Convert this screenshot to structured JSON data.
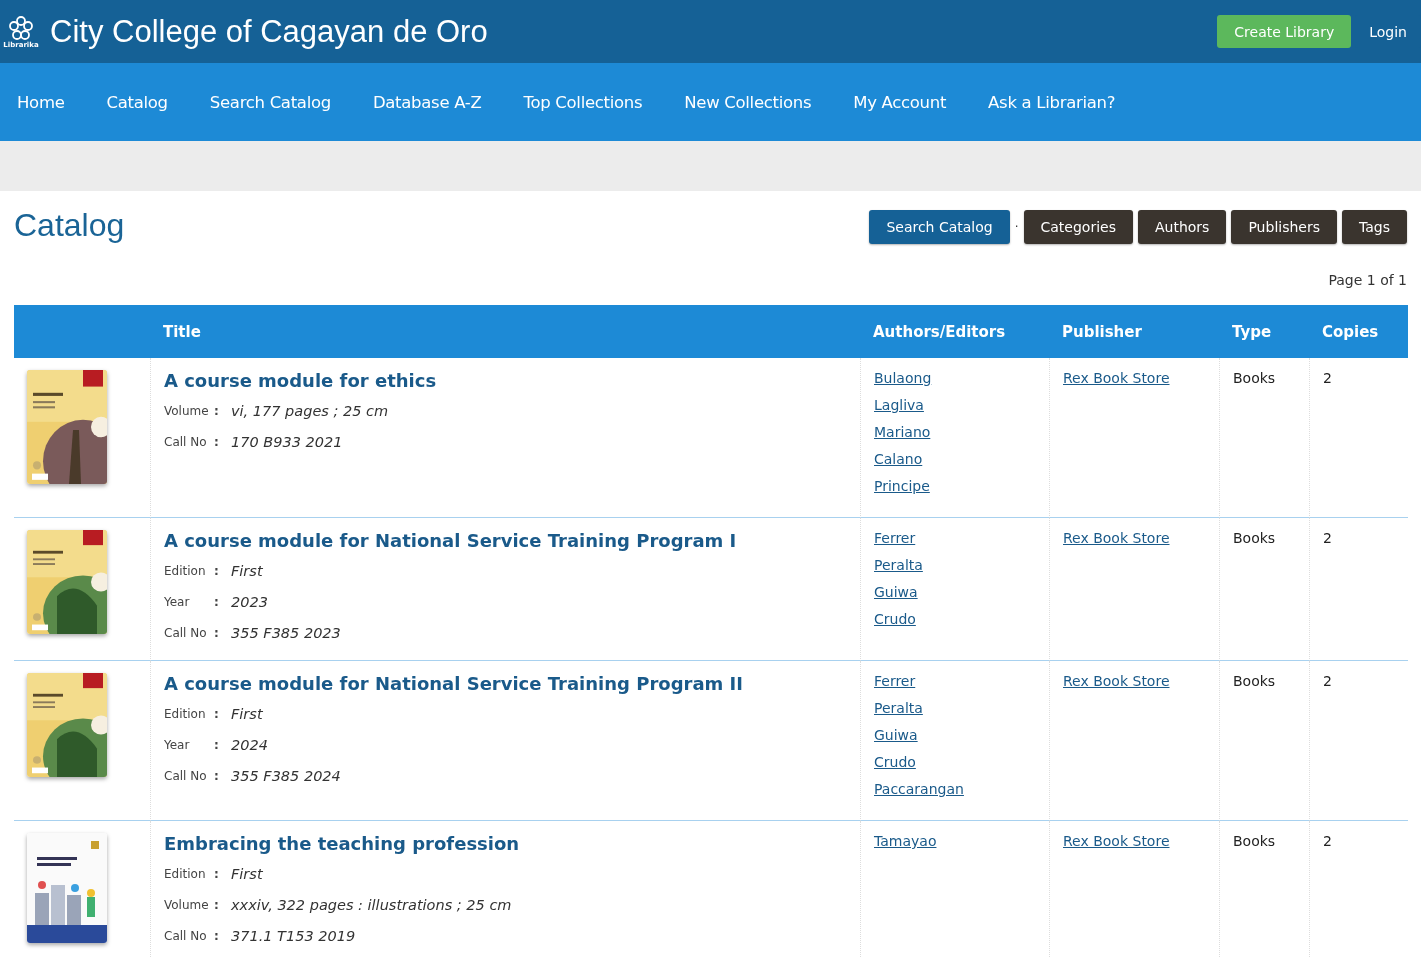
{
  "header": {
    "logo_caption": "Librarika",
    "title": "City College of Cagayan de Oro",
    "buttons": [
      {
        "label": "Create Library",
        "kind": "primary"
      },
      {
        "label": "Login",
        "kind": "plain"
      }
    ]
  },
  "nav": [
    "Home",
    "Catalog",
    "Search Catalog",
    "Database A-Z",
    "Top Collections",
    "New Collections",
    "My Account",
    "Ask a Librarian?"
  ],
  "page": {
    "title": "Catalog",
    "separator": "·",
    "tabs": [
      {
        "label": "Search Catalog",
        "selected": true
      },
      {
        "label": "Categories",
        "selected": false
      },
      {
        "label": "Authors",
        "selected": false
      },
      {
        "label": "Publishers",
        "selected": false
      },
      {
        "label": "Tags",
        "selected": false
      }
    ],
    "pagination": "Page 1 of 1"
  },
  "table": {
    "columns": [
      "Title",
      "Authors/Editors",
      "Publisher",
      "Type",
      "Copies"
    ],
    "rows": [
      {
        "title": "A course module for ethics",
        "details": [
          {
            "label": "Volume",
            "colon": ":",
            "value": "vi, 177 pages ; 25 cm"
          },
          {
            "label": "Call No",
            "colon": ":",
            "value": "170 B933 2021"
          }
        ],
        "authors": [
          "Bulaong",
          "Lagliva",
          "Mariano",
          "Calano",
          "Principe"
        ],
        "publisher": "Rex Book Store",
        "type": "Books",
        "copies": "2"
      },
      {
        "title": "A course module for National Service Training Program I",
        "details": [
          {
            "label": "Edition",
            "colon": ":",
            "value": "First"
          },
          {
            "label": "Year",
            "colon": ":",
            "value": "2023"
          },
          {
            "label": "Call No",
            "colon": ":",
            "value": "355 F385 2023"
          }
        ],
        "authors": [
          "Ferrer",
          "Peralta",
          "Guiwa",
          "Crudo"
        ],
        "publisher": "Rex Book Store",
        "type": "Books",
        "copies": "2"
      },
      {
        "title": "A course module for National Service Training Program II",
        "details": [
          {
            "label": "Edition",
            "colon": ":",
            "value": "First"
          },
          {
            "label": "Year",
            "colon": ":",
            "value": "2024"
          },
          {
            "label": "Call No",
            "colon": ":",
            "value": "355 F385 2024"
          }
        ],
        "authors": [
          "Ferrer",
          "Peralta",
          "Guiwa",
          "Crudo",
          "Paccarangan"
        ],
        "publisher": "Rex Book Store",
        "type": "Books",
        "copies": "2"
      },
      {
        "title": "Embracing the teaching profession",
        "details": [
          {
            "label": "Edition",
            "colon": ":",
            "value": "First"
          },
          {
            "label": "Volume",
            "colon": ":",
            "value": "xxxiv, 322 pages : illustrations ; 25 cm"
          },
          {
            "label": "Call No",
            "colon": ":",
            "value": "371.1 T153 2019"
          }
        ],
        "authors": [
          "Tamayao"
        ],
        "publisher": "Rex Book Store",
        "type": "Books",
        "copies": "2"
      }
    ]
  }
}
